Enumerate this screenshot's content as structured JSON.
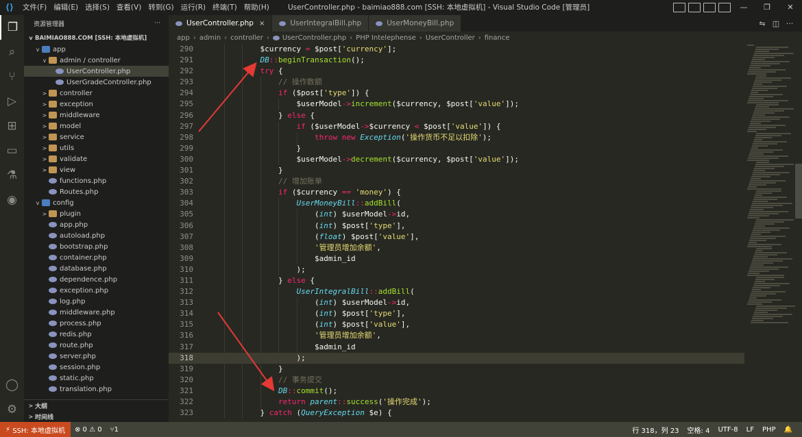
{
  "titlebar": {
    "menu": [
      "文件(F)",
      "编辑(E)",
      "选择(S)",
      "查看(V)",
      "转到(G)",
      "运行(R)",
      "终端(T)",
      "帮助(H)"
    ],
    "title": "UserController.php - baimiao888.com [SSH: 本地虚拟机] - Visual Studio Code [管理员]"
  },
  "sidebar": {
    "header": "资源管理器",
    "more": "···",
    "root": "BAIMIAO888.COM [SSH: 本地虚拟机]",
    "tree": [
      {
        "label": "app",
        "depth": 1,
        "chev": "v",
        "icon": "folder-blue"
      },
      {
        "label": "admin / controller",
        "depth": 2,
        "chev": "v",
        "icon": "folder"
      },
      {
        "label": "UserController.php",
        "depth": 3,
        "chev": "",
        "icon": "php",
        "selected": true
      },
      {
        "label": "UserGradeController.php",
        "depth": 3,
        "chev": "",
        "icon": "php"
      },
      {
        "label": "controller",
        "depth": 2,
        "chev": ">",
        "icon": "folder"
      },
      {
        "label": "exception",
        "depth": 2,
        "chev": ">",
        "icon": "folder"
      },
      {
        "label": "middleware",
        "depth": 2,
        "chev": ">",
        "icon": "folder"
      },
      {
        "label": "model",
        "depth": 2,
        "chev": ">",
        "icon": "folder"
      },
      {
        "label": "service",
        "depth": 2,
        "chev": ">",
        "icon": "folder"
      },
      {
        "label": "utils",
        "depth": 2,
        "chev": ">",
        "icon": "folder"
      },
      {
        "label": "validate",
        "depth": 2,
        "chev": ">",
        "icon": "folder"
      },
      {
        "label": "view",
        "depth": 2,
        "chev": ">",
        "icon": "folder"
      },
      {
        "label": "functions.php",
        "depth": 2,
        "chev": "",
        "icon": "php"
      },
      {
        "label": "Routes.php",
        "depth": 2,
        "chev": "",
        "icon": "php"
      },
      {
        "label": "config",
        "depth": 1,
        "chev": "v",
        "icon": "folder-blue"
      },
      {
        "label": "plugin",
        "depth": 2,
        "chev": ">",
        "icon": "folder"
      },
      {
        "label": "app.php",
        "depth": 2,
        "chev": "",
        "icon": "php"
      },
      {
        "label": "autoload.php",
        "depth": 2,
        "chev": "",
        "icon": "php"
      },
      {
        "label": "bootstrap.php",
        "depth": 2,
        "chev": "",
        "icon": "php"
      },
      {
        "label": "container.php",
        "depth": 2,
        "chev": "",
        "icon": "php"
      },
      {
        "label": "database.php",
        "depth": 2,
        "chev": "",
        "icon": "php"
      },
      {
        "label": "dependence.php",
        "depth": 2,
        "chev": "",
        "icon": "php"
      },
      {
        "label": "exception.php",
        "depth": 2,
        "chev": "",
        "icon": "php"
      },
      {
        "label": "log.php",
        "depth": 2,
        "chev": "",
        "icon": "php"
      },
      {
        "label": "middleware.php",
        "depth": 2,
        "chev": "",
        "icon": "php"
      },
      {
        "label": "process.php",
        "depth": 2,
        "chev": "",
        "icon": "php"
      },
      {
        "label": "redis.php",
        "depth": 2,
        "chev": "",
        "icon": "php"
      },
      {
        "label": "route.php",
        "depth": 2,
        "chev": "",
        "icon": "php"
      },
      {
        "label": "server.php",
        "depth": 2,
        "chev": "",
        "icon": "php"
      },
      {
        "label": "session.php",
        "depth": 2,
        "chev": "",
        "icon": "php"
      },
      {
        "label": "static.php",
        "depth": 2,
        "chev": "",
        "icon": "php"
      },
      {
        "label": "translation.php",
        "depth": 2,
        "chev": "",
        "icon": "php"
      }
    ],
    "outline": "大纲",
    "timeline": "时间线"
  },
  "tabs": [
    {
      "label": "UserController.php",
      "active": true,
      "close": "×"
    },
    {
      "label": "UserIntegralBill.php",
      "active": false
    },
    {
      "label": "UserMoneyBill.php",
      "active": false
    }
  ],
  "breadcrumb": [
    "app",
    "admin",
    "controller",
    "UserController.php",
    "PHP Intelephense",
    "UserController",
    "finance"
  ],
  "code": [
    {
      "n": "290",
      "tokens": [
        [
          "var",
          "$currency"
        ],
        [
          "op",
          " = "
        ],
        [
          "var",
          "$post["
        ],
        [
          "str",
          "'currency'"
        ],
        [
          "var",
          "];"
        ]
      ],
      "indent": 3
    },
    {
      "n": "291",
      "tokens": [
        [
          "cls",
          "DB"
        ],
        [
          "op",
          "::"
        ],
        [
          "fn",
          "beginTransaction"
        ],
        [
          "var",
          "();"
        ]
      ],
      "indent": 3
    },
    {
      "n": "292",
      "tokens": [
        [
          "kw",
          "try"
        ],
        [
          "var",
          " {"
        ]
      ],
      "indent": 3
    },
    {
      "n": "293",
      "tokens": [
        [
          "cmt",
          "// 操作数额"
        ]
      ],
      "indent": 4
    },
    {
      "n": "294",
      "tokens": [
        [
          "kw",
          "if"
        ],
        [
          "var",
          " ($post["
        ],
        [
          "str",
          "'type'"
        ],
        [
          "var",
          "]) {"
        ]
      ],
      "indent": 4
    },
    {
      "n": "295",
      "tokens": [
        [
          "var",
          "$userModel"
        ],
        [
          "op",
          "->"
        ],
        [
          "fn",
          "increment"
        ],
        [
          "var",
          "($currency, $post["
        ],
        [
          "str",
          "'value'"
        ],
        [
          "var",
          "]);"
        ]
      ],
      "indent": 5
    },
    {
      "n": "296",
      "tokens": [
        [
          "var",
          "} "
        ],
        [
          "kw",
          "else"
        ],
        [
          "var",
          " {"
        ]
      ],
      "indent": 4
    },
    {
      "n": "297",
      "tokens": [
        [
          "kw",
          "if"
        ],
        [
          "var",
          " ($userModel"
        ],
        [
          "op",
          "->"
        ],
        [
          "var",
          "$currency "
        ],
        [
          "op",
          "<"
        ],
        [
          "var",
          " $post["
        ],
        [
          "str",
          "'value'"
        ],
        [
          "var",
          "]) {"
        ]
      ],
      "indent": 5
    },
    {
      "n": "298",
      "tokens": [
        [
          "kw",
          "throw"
        ],
        [
          "var",
          " "
        ],
        [
          "kw",
          "new"
        ],
        [
          "var",
          " "
        ],
        [
          "cls",
          "Exception"
        ],
        [
          "var",
          "("
        ],
        [
          "str",
          "'操作货币不足以扣除'"
        ],
        [
          "var",
          ");"
        ]
      ],
      "indent": 6
    },
    {
      "n": "299",
      "tokens": [
        [
          "var",
          "}"
        ]
      ],
      "indent": 5
    },
    {
      "n": "300",
      "tokens": [
        [
          "var",
          "$userModel"
        ],
        [
          "op",
          "->"
        ],
        [
          "fn",
          "decrement"
        ],
        [
          "var",
          "($currency, $post["
        ],
        [
          "str",
          "'value'"
        ],
        [
          "var",
          "]);"
        ]
      ],
      "indent": 5
    },
    {
      "n": "301",
      "tokens": [
        [
          "var",
          "}"
        ]
      ],
      "indent": 4
    },
    {
      "n": "302",
      "tokens": [
        [
          "cmt",
          "// 增加账单"
        ]
      ],
      "indent": 4
    },
    {
      "n": "303",
      "tokens": [
        [
          "kw",
          "if"
        ],
        [
          "var",
          " ($currency "
        ],
        [
          "op",
          "=="
        ],
        [
          "var",
          " "
        ],
        [
          "str",
          "'money'"
        ],
        [
          "var",
          ") {"
        ]
      ],
      "indent": 4
    },
    {
      "n": "304",
      "tokens": [
        [
          "cls",
          "UserMoneyBill"
        ],
        [
          "op",
          "::"
        ],
        [
          "fn",
          "addBill"
        ],
        [
          "var",
          "("
        ]
      ],
      "indent": 5
    },
    {
      "n": "305",
      "tokens": [
        [
          "var",
          "("
        ],
        [
          "cast",
          "int"
        ],
        [
          "var",
          ") $userModel"
        ],
        [
          "op",
          "->"
        ],
        [
          "var",
          "id,"
        ]
      ],
      "indent": 6
    },
    {
      "n": "306",
      "tokens": [
        [
          "var",
          "("
        ],
        [
          "cast",
          "int"
        ],
        [
          "var",
          ") $post["
        ],
        [
          "str",
          "'type'"
        ],
        [
          "var",
          "],"
        ]
      ],
      "indent": 6
    },
    {
      "n": "307",
      "tokens": [
        [
          "var",
          "("
        ],
        [
          "cast",
          "float"
        ],
        [
          "var",
          ") $post["
        ],
        [
          "str",
          "'value'"
        ],
        [
          "var",
          "],"
        ]
      ],
      "indent": 6
    },
    {
      "n": "308",
      "tokens": [
        [
          "str",
          "'管理员增加余额'"
        ],
        [
          "var",
          ","
        ]
      ],
      "indent": 6
    },
    {
      "n": "309",
      "tokens": [
        [
          "var",
          "$admin_id"
        ]
      ],
      "indent": 6
    },
    {
      "n": "310",
      "tokens": [
        [
          "var",
          ");"
        ]
      ],
      "indent": 5
    },
    {
      "n": "311",
      "tokens": [
        [
          "var",
          "} "
        ],
        [
          "kw",
          "else"
        ],
        [
          "var",
          " {"
        ]
      ],
      "indent": 4
    },
    {
      "n": "312",
      "tokens": [
        [
          "cls",
          "UserIntegralBill"
        ],
        [
          "op",
          "::"
        ],
        [
          "fn",
          "addBill"
        ],
        [
          "var",
          "("
        ]
      ],
      "indent": 5
    },
    {
      "n": "313",
      "tokens": [
        [
          "var",
          "("
        ],
        [
          "cast",
          "int"
        ],
        [
          "var",
          ") $userModel"
        ],
        [
          "op",
          "->"
        ],
        [
          "var",
          "id,"
        ]
      ],
      "indent": 6
    },
    {
      "n": "314",
      "tokens": [
        [
          "var",
          "("
        ],
        [
          "cast",
          "int"
        ],
        [
          "var",
          ") $post["
        ],
        [
          "str",
          "'type'"
        ],
        [
          "var",
          "],"
        ]
      ],
      "indent": 6
    },
    {
      "n": "315",
      "tokens": [
        [
          "var",
          "("
        ],
        [
          "cast",
          "int"
        ],
        [
          "var",
          ") $post["
        ],
        [
          "str",
          "'value'"
        ],
        [
          "var",
          "],"
        ]
      ],
      "indent": 6
    },
    {
      "n": "316",
      "tokens": [
        [
          "str",
          "'管理员增加余额'"
        ],
        [
          "var",
          ","
        ]
      ],
      "indent": 6
    },
    {
      "n": "317",
      "tokens": [
        [
          "var",
          "$admin_id"
        ]
      ],
      "indent": 6
    },
    {
      "n": "318",
      "tokens": [
        [
          "var",
          ");"
        ]
      ],
      "indent": 5,
      "current": true
    },
    {
      "n": "319",
      "tokens": [
        [
          "var",
          "}"
        ]
      ],
      "indent": 4
    },
    {
      "n": "320",
      "tokens": [
        [
          "cmt",
          "// 事务提交"
        ]
      ],
      "indent": 4
    },
    {
      "n": "321",
      "tokens": [
        [
          "cls",
          "DB"
        ],
        [
          "op",
          "::"
        ],
        [
          "fn",
          "commit"
        ],
        [
          "var",
          "();"
        ]
      ],
      "indent": 4
    },
    {
      "n": "322",
      "tokens": [
        [
          "kw",
          "return"
        ],
        [
          "var",
          " "
        ],
        [
          "cls",
          "parent"
        ],
        [
          "op",
          "::"
        ],
        [
          "fn",
          "success"
        ],
        [
          "var",
          "("
        ],
        [
          "str",
          "'操作完成'"
        ],
        [
          "var",
          ");"
        ]
      ],
      "indent": 4
    },
    {
      "n": "323",
      "tokens": [
        [
          "var",
          "} "
        ],
        [
          "kw",
          "catch"
        ],
        [
          "var",
          " ("
        ],
        [
          "cls",
          "QueryException"
        ],
        [
          "var",
          " $e) {"
        ]
      ],
      "indent": 3
    }
  ],
  "statusbar": {
    "remote": "SSH: 本地虚拟机",
    "problems": "⊗ 0 ⚠ 0",
    "ports": "1",
    "position": "行 318，列 23",
    "spaces": "空格: 4",
    "encoding": "UTF-8",
    "eol": "LF",
    "language": "PHP"
  },
  "colors": {
    "annotation_arrow": "#e53935"
  }
}
